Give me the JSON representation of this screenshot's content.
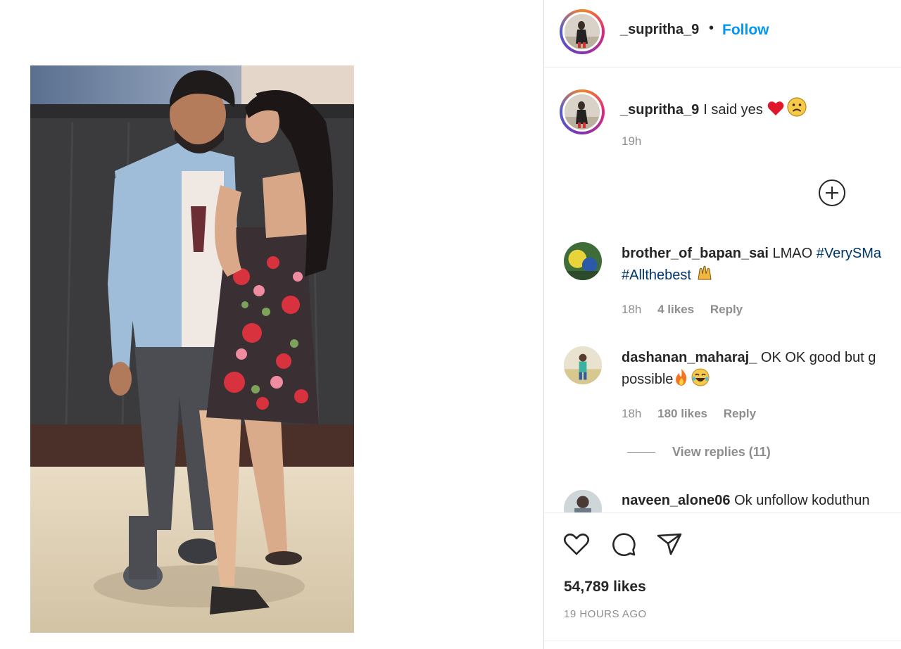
{
  "post": {
    "author": "_supritha_9",
    "separator": "•",
    "follow_label": "Follow",
    "caption": {
      "username": "_supritha_9",
      "text": "I said yes",
      "time": "19h"
    },
    "likes": "54,789 likes",
    "posted_ago": "19 HOURS AGO"
  },
  "comments": [
    {
      "username": "brother_of_bapan_sai",
      "text": "LMAO",
      "hashtag1": "#VerySMa",
      "hashtag2": "#Allthebest",
      "time": "18h",
      "likes": "4 likes",
      "reply": "Reply"
    },
    {
      "username": "dashanan_maharaj_",
      "text": "OK OK good but g",
      "text2": "possible",
      "time": "18h",
      "likes": "180 likes",
      "reply": "Reply",
      "view_replies": "View replies (11)"
    },
    {
      "username": "naveen_alone06",
      "text": "Ok unfollow koduthun"
    }
  ],
  "icons": {
    "like": "heart-icon",
    "comment": "comment-icon",
    "share": "paper-plane-icon",
    "load_more": "plus-circle-icon"
  },
  "colors": {
    "follow_blue": "#0095f6",
    "hashtag": "#00376b",
    "muted": "#8e8e8e",
    "text": "#262626"
  }
}
